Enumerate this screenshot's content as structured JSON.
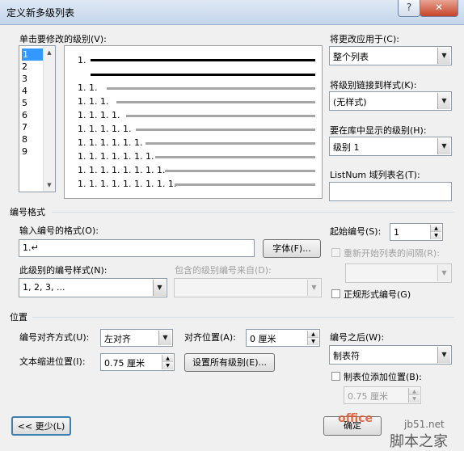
{
  "window": {
    "title": "定义新多级列表",
    "help_icon": "?",
    "close_icon": "✕"
  },
  "level_selector": {
    "label": "单击要修改的级别(V):",
    "items": [
      "1",
      "2",
      "3",
      "4",
      "5",
      "6",
      "7",
      "8",
      "9"
    ],
    "selected_index": 0
  },
  "preview": {
    "numbers": [
      "1.",
      "1. 1.",
      "1. 1. 1.",
      "1. 1. 1. 1.",
      "1. 1. 1. 1. 1.",
      "1. 1. 1. 1. 1. 1.",
      "1. 1. 1. 1. 1. 1. 1.",
      "1. 1. 1. 1. 1. 1. 1. 1.",
      "1. 1. 1. 1. 1. 1. 1. 1. 1."
    ]
  },
  "right_panel": {
    "apply_to_label": "将更改应用于(C):",
    "apply_to_value": "整个列表",
    "link_style_label": "将级别链接到样式(K):",
    "link_style_value": "(无样式)",
    "gallery_level_label": "要在库中显示的级别(H):",
    "gallery_level_value": "级别 1",
    "listnum_label": "ListNum 域列表名(T):",
    "listnum_value": ""
  },
  "number_format": {
    "group_label": "编号格式",
    "format_label": "输入编号的格式(O):",
    "format_value": "1.↵",
    "font_button": "字体(F)...",
    "style_label": "此级别的编号样式(N):",
    "style_value": "1, 2, 3, ...",
    "include_from_label": "包含的级别编号来自(D):",
    "include_from_value": "",
    "start_at_label": "起始编号(S):",
    "start_at_value": "1",
    "restart_label": "重新开始列表的间隔(R):",
    "restart_value": "",
    "legal_label": "正规形式编号(G)"
  },
  "position": {
    "group_label": "位置",
    "alignment_label": "编号对齐方式(U):",
    "alignment_value": "左对齐",
    "aligned_at_label": "对齐位置(A):",
    "aligned_at_value": "0 厘米",
    "indent_label": "文本缩进位置(I):",
    "indent_value": "0.75 厘米",
    "set_all_button": "设置所有级别(E)...",
    "follow_with_label": "编号之后(W):",
    "follow_with_value": "制表符",
    "tab_stop_label": "制表位添加位置(B):",
    "tab_stop_value": "0.75 厘米"
  },
  "footer": {
    "less_button": "<< 更少(L)",
    "ok_button": "确定"
  },
  "watermark": {
    "site": "jb51.net",
    "name": "脚本之家",
    "office_text": "office"
  }
}
